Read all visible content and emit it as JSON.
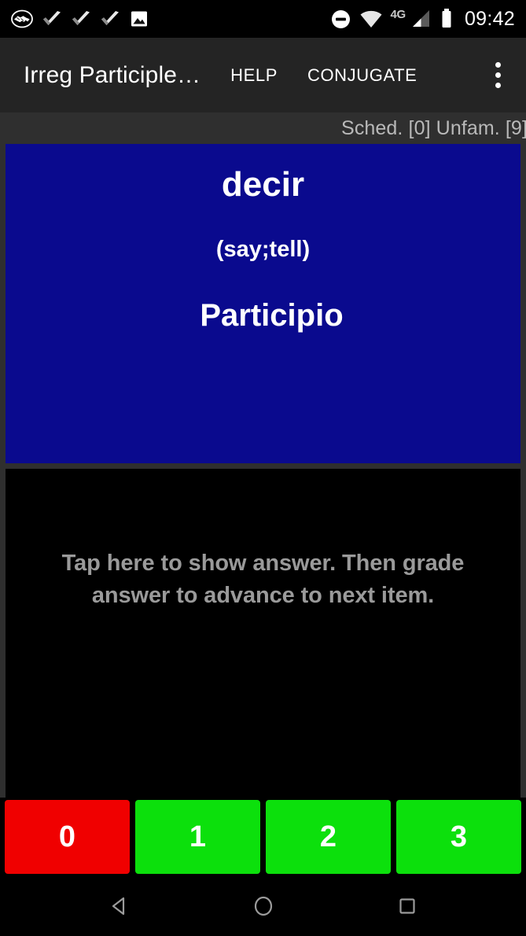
{
  "status_bar": {
    "icons_left": [
      {
        "name": "handshake-icon",
        "label": "handshake"
      },
      {
        "name": "check-icon-1",
        "label": "check"
      },
      {
        "name": "check-icon-2",
        "label": "check"
      },
      {
        "name": "check-icon-3",
        "label": "check"
      },
      {
        "name": "image-icon",
        "label": "image"
      }
    ],
    "icons_right": [
      {
        "name": "do-not-disturb-icon",
        "label": "do-not-disturb"
      },
      {
        "name": "wifi-icon",
        "label": "wifi"
      }
    ],
    "network_type": "4G",
    "signal_icon": "signal-bars-icon",
    "battery_icon": "battery-icon",
    "time": "09:42"
  },
  "app_bar": {
    "title": "Irreg Participle…",
    "help_label": "HELP",
    "conjugate_label": "CONJUGATE",
    "overflow_label": "More options"
  },
  "stats": {
    "text": "Sched. [0] Unfam. [9]",
    "scheduled_count": "0",
    "unfamiliar_count": "9"
  },
  "card": {
    "term": "decir",
    "gloss": "(say;tell)",
    "form": "Participio",
    "answer_hint": "Tap here to show answer. Then grade answer to advance to next item.",
    "question_bg": "#0a0a8e",
    "answer_bg": "#000000",
    "hint_color": "#9a9a9a"
  },
  "grade_buttons": [
    {
      "label": "0",
      "color": "#f00000"
    },
    {
      "label": "1",
      "color": "#0ce00c"
    },
    {
      "label": "2",
      "color": "#0ce00c"
    },
    {
      "label": "3",
      "color": "#0ce00c"
    }
  ],
  "nav_bar": {
    "back_label": "Back",
    "home_label": "Home",
    "recents_label": "Recents"
  }
}
